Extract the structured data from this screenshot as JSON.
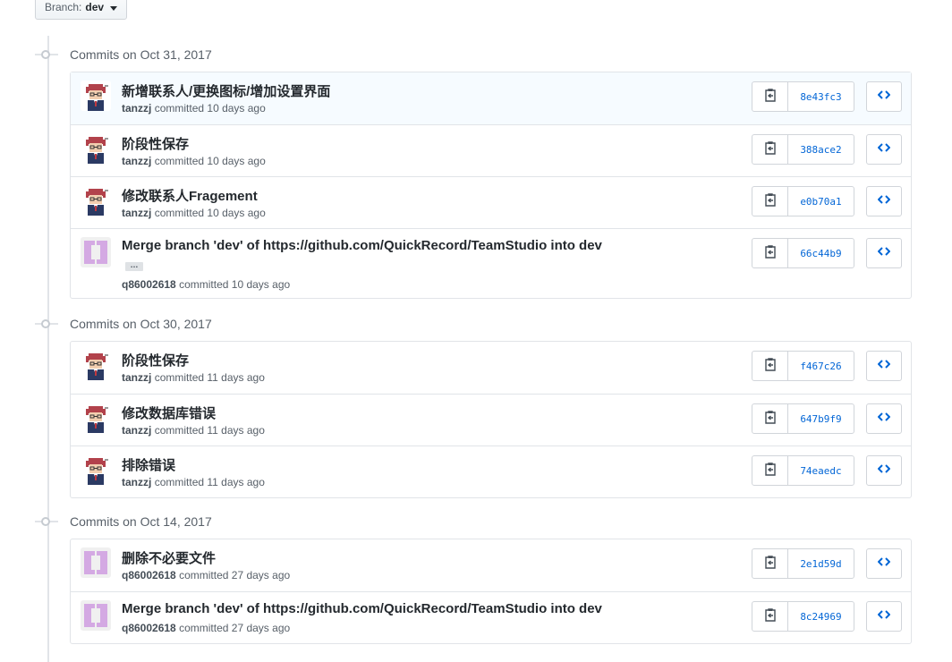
{
  "branch": {
    "prefix": "Branch:",
    "name": "dev"
  },
  "groups": [
    {
      "header": "Commits on Oct 31, 2017",
      "commits": [
        {
          "message": "新增联系人/更换图标/增加设置界面",
          "author": "tanzzj",
          "action": "committed",
          "when": "10 days ago",
          "sha": "8e43fc3",
          "avatar": "person"
        },
        {
          "message": "阶段性保存",
          "author": "tanzzj",
          "action": "committed",
          "when": "10 days ago",
          "sha": "388ace2",
          "avatar": "person"
        },
        {
          "message": "修改联系人Fragement",
          "author": "tanzzj",
          "action": "committed",
          "when": "10 days ago",
          "sha": "e0b70a1",
          "avatar": "person"
        },
        {
          "message": "Merge branch 'dev' of https://github.com/QuickRecord/TeamStudio into dev",
          "author": "q86002618",
          "action": "committed",
          "when": "10 days ago",
          "sha": "66c44b9",
          "avatar": "identicon",
          "ellipsis": "…"
        }
      ]
    },
    {
      "header": "Commits on Oct 30, 2017",
      "commits": [
        {
          "message": "阶段性保存",
          "author": "tanzzj",
          "action": "committed",
          "when": "11 days ago",
          "sha": "f467c26",
          "avatar": "person"
        },
        {
          "message": "修改数据库错误",
          "author": "tanzzj",
          "action": "committed",
          "when": "11 days ago",
          "sha": "647b9f9",
          "avatar": "person"
        },
        {
          "message": "排除错误",
          "author": "tanzzj",
          "action": "committed",
          "when": "11 days ago",
          "sha": "74eaedc",
          "avatar": "person"
        }
      ]
    },
    {
      "header": "Commits on Oct 14, 2017",
      "commits": [
        {
          "message": "删除不必要文件",
          "author": "q86002618",
          "action": "committed",
          "when": "27 days ago",
          "sha": "2e1d59d",
          "avatar": "identicon"
        },
        {
          "message": "Merge branch 'dev' of https://github.com/QuickRecord/TeamStudio into dev",
          "author": "q86002618",
          "action": "committed",
          "when": "27 days ago",
          "sha": "8c24969",
          "avatar": "identicon"
        }
      ]
    }
  ],
  "icons": {
    "copy": "clipboard-icon",
    "browse": "code-brackets-icon",
    "branch_dropdown": "caret-down-icon"
  },
  "colors": {
    "link": "#0366d6",
    "border": "#e1e4e8",
    "highlight": "#f6fbff",
    "identicon": "#d4a9e3"
  }
}
